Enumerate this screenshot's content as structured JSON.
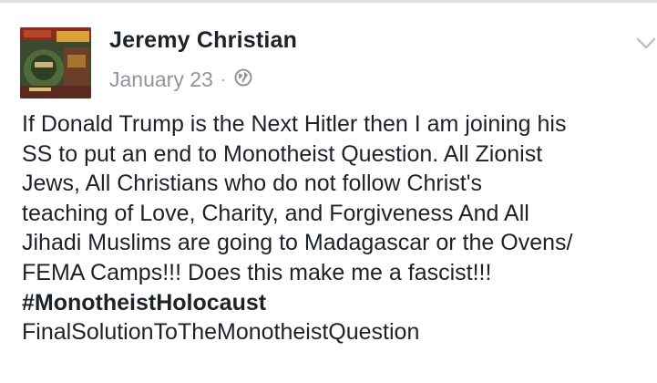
{
  "post": {
    "author_name": "Jeremy Christian",
    "date": "January 23",
    "separator": "·",
    "privacy_icon": "globe-icon",
    "options_icon": "chevron-down-icon",
    "lines": [
      "If Donald Trump is the Next Hitler then I am joining his",
      "SS to put an end to Monotheist Question. All Zionist",
      "Jews, All Christians who do not follow Christ's",
      "teaching of Love, Charity, and Forgiveness And All",
      "Jihadi Muslims are going to Madagascar or the Ovens/",
      "FEMA Camps!!! Does this make me a fascist!!!"
    ],
    "hashtag": "#MonotheistHolocaust",
    "last_line": "FinalSolutionToTheMonotheistQuestion"
  },
  "colors": {
    "text": "#1d2129",
    "meta": "#90949c",
    "border": "#dddfe2"
  }
}
